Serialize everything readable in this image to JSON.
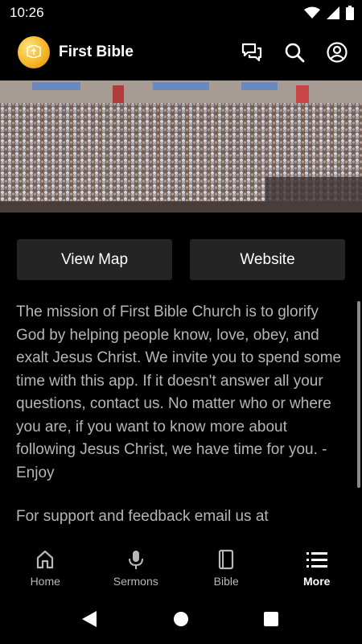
{
  "status_bar": {
    "time": "10:26",
    "icons": [
      "wifi-icon",
      "signal-icon",
      "battery-icon"
    ]
  },
  "app_bar": {
    "title": "First Bible",
    "logo": "church-logo",
    "actions": [
      "chat-icon",
      "search-icon",
      "account-icon"
    ]
  },
  "hero": {
    "image": "congregation-photo"
  },
  "buttons": {
    "view_map": "View Map",
    "website": "Website"
  },
  "content": {
    "mission": "The mission of First Bible Church is to glorify God by helping people know, love, obey, and exalt Jesus Christ. We invite you to spend some time with this app. If it doesn't answer all your questions, contact us. No matter who or where you are, if you want to know more about following Jesus Christ, we have time for you. - Enjoy",
    "support": "For support and feedback email us at"
  },
  "bottom_nav": {
    "items": [
      {
        "label": "Home",
        "icon": "home-icon"
      },
      {
        "label": "Sermons",
        "icon": "microphone-icon"
      },
      {
        "label": "Bible",
        "icon": "book-icon"
      },
      {
        "label": "More",
        "icon": "list-icon"
      }
    ],
    "active": "More"
  },
  "colors": {
    "background": "#000000",
    "button_bg": "#242424",
    "body_text": "#b6b6b6",
    "nav_inactive": "#b8b8b8",
    "logo_gold": "#f4b223"
  }
}
